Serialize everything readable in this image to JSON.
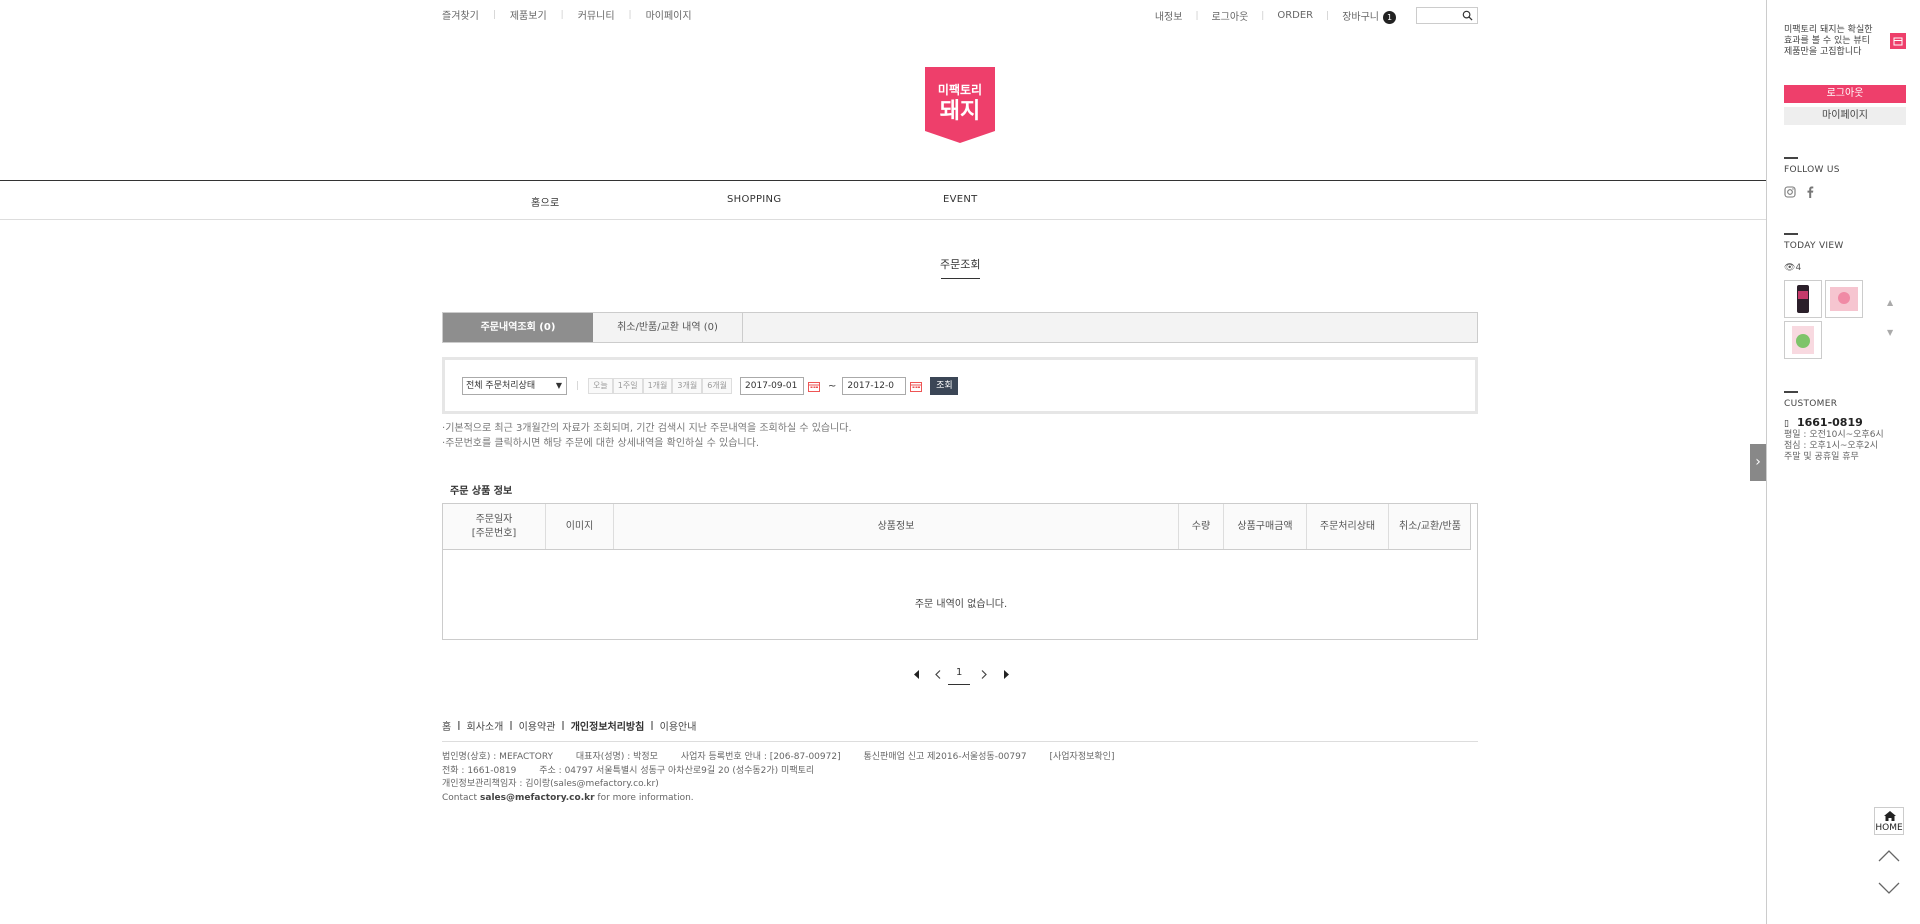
{
  "top_nav": {
    "left": [
      "즐겨찾기",
      "제품보기",
      "커뮤니티",
      "마이페이지"
    ],
    "right": [
      "내정보",
      "로그아웃",
      "ORDER",
      "장바구니"
    ],
    "cart_count": "1"
  },
  "logo": {
    "line1": "미팩토리",
    "line2": "돼지"
  },
  "main_nav": [
    "홈으로",
    "SHOPPING",
    "EVENT"
  ],
  "page_title": "주문조회",
  "tabs": [
    {
      "label": "주문내역조회 (0)",
      "active": true
    },
    {
      "label": "취소/반품/교환 내역 (0)",
      "active": false
    }
  ],
  "filter": {
    "status_select": "전체 주문처리상태",
    "periods": [
      "오늘",
      "1주일",
      "1개월",
      "3개월",
      "6개월"
    ],
    "date_from": "2017-09-01",
    "date_to": "2017-12-0",
    "search_button": "조회"
  },
  "notes": [
    "기본적으로 최근 3개월간의 자료가 조회되며, 기간 검색시 지난 주문내역을 조회하실 수 있습니다.",
    "주문번호를 클릭하시면 해당 주문에 대한 상세내역을 확인하실 수 있습니다."
  ],
  "order_section_title": "주문 상품 정보",
  "table": {
    "headers": [
      "주문일자\n[주문번호]",
      "이미지",
      "상품정보",
      "수량",
      "상품구매금액",
      "주문처리상태",
      "취소/교환/반품"
    ],
    "empty_message": "주문 내역이 없습니다."
  },
  "pagination": {
    "current": "1"
  },
  "footer": {
    "links": [
      "홈",
      "회사소개",
      "이용약관",
      "개인정보처리방침",
      "이용안내"
    ],
    "info_rows": [
      [
        "법인명(상호) : MEFACTORY",
        "대표자(성명) : 박정모",
        "사업자 등록번호 안내 : [206-87-00972]",
        "통신판매업 신고 제2016-서울성동-00797",
        "[사업자정보확인]"
      ],
      [
        "전화 : 1661-0819",
        "주소 : 04797 서울특별시 성동구 아차산로9길 20 (성수동2가) 미팩토리"
      ],
      [
        "개인정보관리책임자 : 김이랑(sales@mefactory.co.kr)"
      ]
    ],
    "contact_prefix": "Contact",
    "contact_email": "sales@mefactory.co.kr",
    "contact_suffix": "for more information."
  },
  "sidebar": {
    "intro": "미팩토리 돼지는 확실한 효과를 볼 수 있는 뷰티 제품만을 고집합니다",
    "logout": "로그아웃",
    "mypage": "마이페이지",
    "follow_us": "FOLLOW US",
    "today_view": "TODAY VIEW",
    "view_count": "4",
    "customer": "CUSTOMER",
    "phone": "1661-0819",
    "hours": [
      "평일 : 오전10시~오후6시",
      "점심 : 오후1시~오후2시",
      "주말 및 공휴일 휴무"
    ],
    "home": "HOME"
  },
  "colors": {
    "accent": "#ee3f6b",
    "button_dark": "#3b4656",
    "tab_active": "#8e8e8e"
  }
}
